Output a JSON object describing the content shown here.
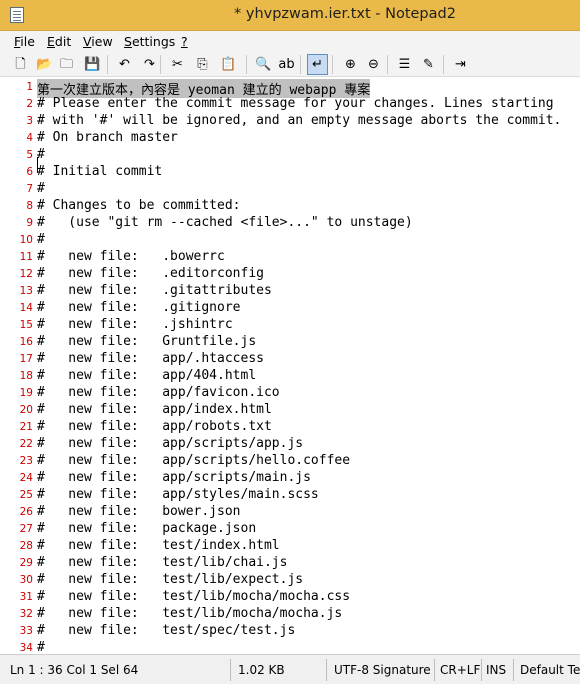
{
  "window": {
    "title": "* yhvpzwam.ier.txt - Notepad2"
  },
  "menu": {
    "items": [
      {
        "acc": "F",
        "rest": "ile"
      },
      {
        "acc": "E",
        "rest": "dit"
      },
      {
        "acc": "V",
        "rest": "iew"
      },
      {
        "acc": "S",
        "rest": "ettings"
      },
      {
        "acc": "?",
        "rest": ""
      }
    ]
  },
  "toolbar": {
    "icons": [
      "new-file-icon",
      "open-folder-icon",
      "browse-icon",
      "save-icon",
      "undo-icon",
      "redo-icon",
      "cut-icon",
      "copy-icon",
      "paste-icon",
      "find-icon",
      "replace-icon",
      "word-wrap-icon",
      "zoom-in-icon",
      "zoom-out-icon",
      "scheme-icon",
      "customize-icon",
      "exit-icon"
    ],
    "glyphs": [
      "🗋",
      "📂",
      "🗀",
      "💾",
      "↶",
      "↷",
      "✂",
      "⎘",
      "📋",
      "🔍",
      "ab",
      "↵",
      "⊕",
      "⊖",
      "☰",
      "✎",
      "⇥"
    ],
    "active_index": 11
  },
  "editor": {
    "lines": [
      "第一次建立版本，內容是 yeoman 建立的 webapp 專案",
      "# Please enter the commit message for your changes. Lines starting",
      "# with '#' will be ignored, and an empty message aborts the commit.",
      "# On branch master",
      "#",
      "# Initial commit",
      "#",
      "# Changes to be committed:",
      "#   (use \"git rm --cached <file>...\" to unstage)",
      "#",
      "#   new file:   .bowerrc",
      "#   new file:   .editorconfig",
      "#   new file:   .gitattributes",
      "#   new file:   .gitignore",
      "#   new file:   .jshintrc",
      "#   new file:   Gruntfile.js",
      "#   new file:   app/.htaccess",
      "#   new file:   app/404.html",
      "#   new file:   app/favicon.ico",
      "#   new file:   app/index.html",
      "#   new file:   app/robots.txt",
      "#   new file:   app/scripts/app.js",
      "#   new file:   app/scripts/hello.coffee",
      "#   new file:   app/scripts/main.js",
      "#   new file:   app/styles/main.scss",
      "#   new file:   bower.json",
      "#   new file:   package.json",
      "#   new file:   test/index.html",
      "#   new file:   test/lib/chai.js",
      "#   new file:   test/lib/expect.js",
      "#   new file:   test/lib/mocha/mocha.css",
      "#   new file:   test/lib/mocha/mocha.js",
      "#   new file:   test/spec/test.js",
      "#"
    ],
    "selected_line": 0
  },
  "status": {
    "position": "Ln 1 : 36   Col 1   Sel 64",
    "size": "1.02 KB",
    "encoding": "UTF-8 Signature",
    "line_ending": "CR+LF",
    "mode": "INS",
    "scheme": "Default Text"
  }
}
